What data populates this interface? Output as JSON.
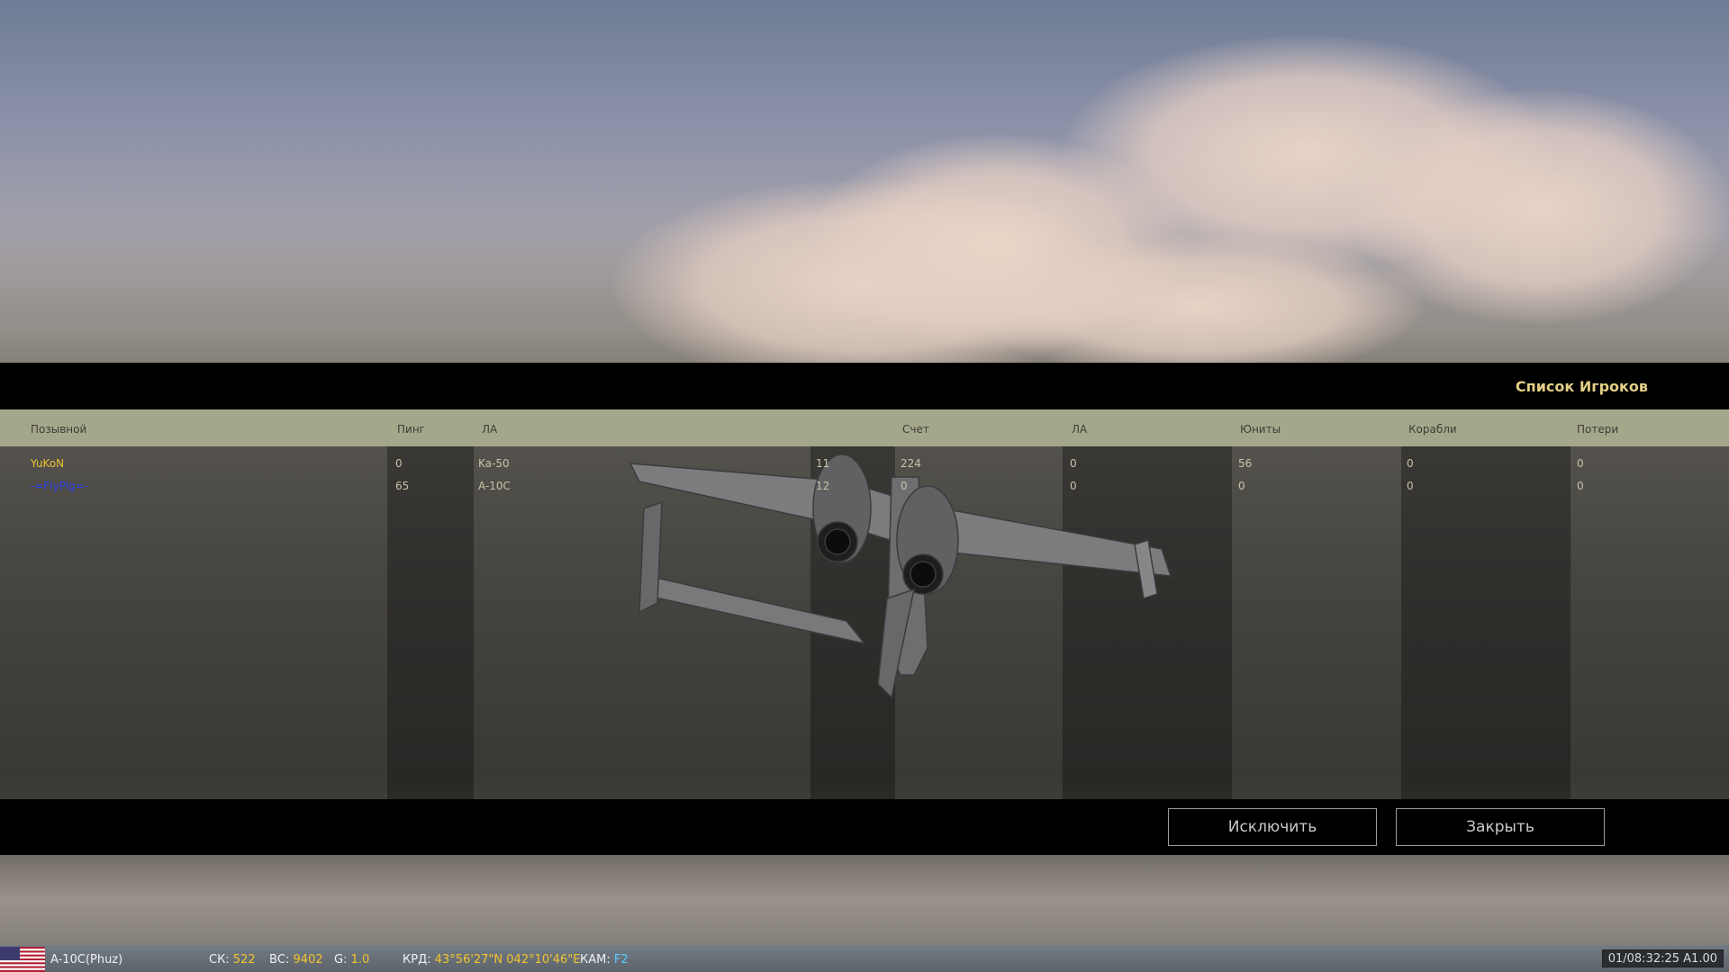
{
  "panel": {
    "title": "Список Игроков",
    "columns": [
      "Позывной",
      "Пинг",
      "ЛА",
      "Счет",
      "ЛА",
      "Юниты",
      "Корабли",
      "Потери"
    ],
    "rows": [
      {
        "callsign": "YuKoN",
        "ping": "0",
        "aircraft": "Ka-50",
        "num": "11",
        "score": "224",
        "air_kills": "0",
        "units": "56",
        "ships": "0",
        "losses": "0"
      },
      {
        "callsign": "-=FlyPig=-",
        "ping": "65",
        "aircraft": "A-10C",
        "num": "12",
        "score": "0",
        "air_kills": "0",
        "units": "0",
        "ships": "0",
        "losses": "0"
      }
    ],
    "buttons": {
      "kick": "Исключить",
      "close": "Закрыть"
    }
  },
  "status_bar": {
    "unit": "A-10C(Phuz)",
    "speed_label": "СК:",
    "speed_value": "522",
    "alt_label": "ВС:",
    "alt_value": "9402",
    "g_label": "G:",
    "g_value": "1.0",
    "coord_label": "КРД:",
    "coord_value": "43°56'27\"N 042°10'46\"E",
    "cam_label": "КАМ:",
    "cam_value": "F2",
    "time": "01/08:32:25 A1.00"
  },
  "colors": {
    "title": "#e3cf86",
    "header_bar": "#a5a78b",
    "callsign_1": "#e8c233",
    "callsign_2": "#2a3ee8",
    "value_highlight": "#f2c430",
    "camera": "#58d0ff"
  },
  "icons": {
    "flag": "us-flag-icon"
  }
}
